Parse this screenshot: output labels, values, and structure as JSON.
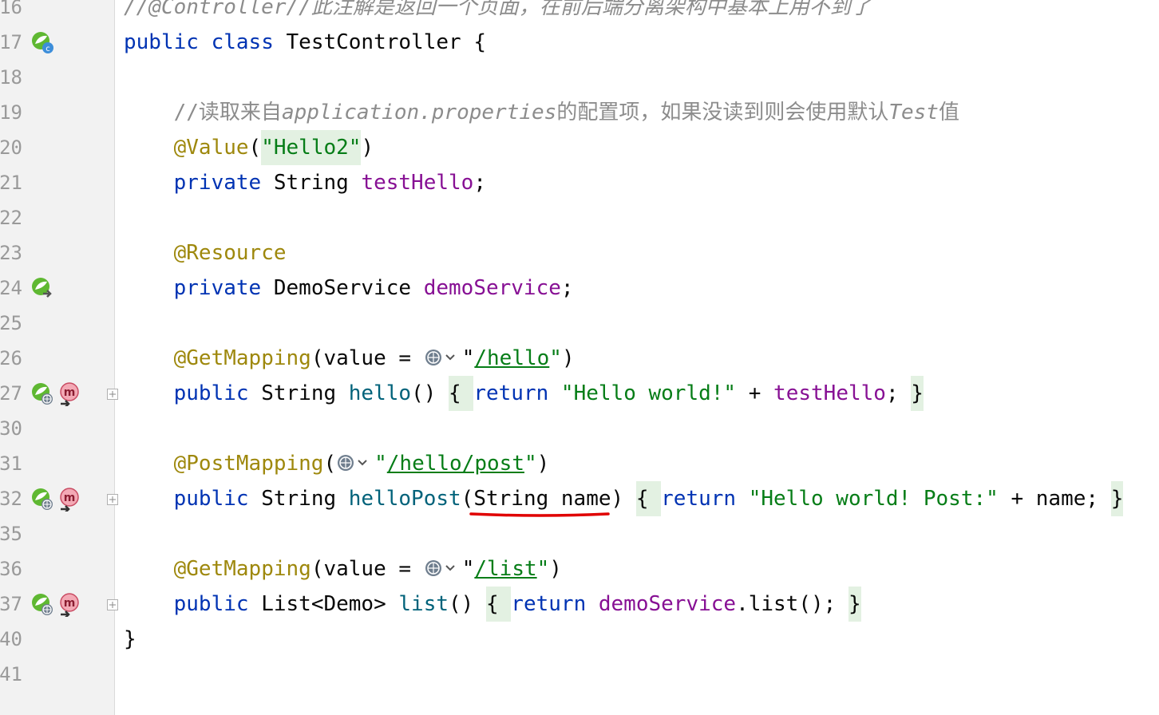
{
  "editor": {
    "lines": [
      {
        "num": "16",
        "parts": [
          {
            "t": "//@Controller//此注解是返回一个页面，在前后端分离架构中基本上用不到了",
            "c": "cmt ital"
          }
        ]
      },
      {
        "num": "17",
        "gutter": [
          "spring-bean-icon"
        ],
        "parts": [
          {
            "t": "public",
            "c": "kw"
          },
          {
            "t": " "
          },
          {
            "t": "class",
            "c": "kw"
          },
          {
            "t": " TestController {"
          }
        ]
      },
      {
        "num": "18",
        "parts": []
      },
      {
        "num": "19",
        "parts": [
          {
            "t": "    "
          },
          {
            "t": "//读取来自",
            "c": "cmt"
          },
          {
            "t": "application.properties",
            "c": "cmt ital"
          },
          {
            "t": "的配置项，如果没读到则会使用默认",
            "c": "cmt"
          },
          {
            "t": "Test",
            "c": "cmt ital"
          },
          {
            "t": "值",
            "c": "cmt"
          }
        ]
      },
      {
        "num": "20",
        "parts": [
          {
            "t": "    "
          },
          {
            "t": "@Value",
            "c": "ann"
          },
          {
            "t": "("
          },
          {
            "t": "\"Hello2\"",
            "c": "str hl"
          },
          {
            "t": ")"
          }
        ]
      },
      {
        "num": "21",
        "parts": [
          {
            "t": "    "
          },
          {
            "t": "private",
            "c": "kw"
          },
          {
            "t": " String "
          },
          {
            "t": "testHello",
            "c": "fld"
          },
          {
            "t": ";"
          }
        ]
      },
      {
        "num": "22",
        "parts": []
      },
      {
        "num": "23",
        "parts": [
          {
            "t": "    "
          },
          {
            "t": "@Resource",
            "c": "ann"
          }
        ]
      },
      {
        "num": "24",
        "gutter": [
          "autowired-icon"
        ],
        "parts": [
          {
            "t": "    "
          },
          {
            "t": "private",
            "c": "kw"
          },
          {
            "t": " DemoService "
          },
          {
            "t": "demoService",
            "c": "fld"
          },
          {
            "t": ";"
          }
        ]
      },
      {
        "num": "25",
        "parts": []
      },
      {
        "num": "26",
        "parts": [
          {
            "t": "    "
          },
          {
            "t": "@GetMapping",
            "c": "ann"
          },
          {
            "t": "(value = "
          },
          {
            "inlay": "globe-icon"
          },
          {
            "t": "\""
          },
          {
            "t": "/hello",
            "c": "url"
          },
          {
            "t": "\"",
            "c": "str"
          },
          {
            "t": ")"
          }
        ]
      },
      {
        "num": "27",
        "gutter": [
          "request-mapping-icon",
          "method-icon"
        ],
        "fold": true,
        "parts": [
          {
            "t": "    "
          },
          {
            "t": "public",
            "c": "kw"
          },
          {
            "t": " String "
          },
          {
            "t": "hello",
            "c": "mth"
          },
          {
            "t": "() "
          },
          {
            "t": "{ ",
            "c": "hl"
          },
          {
            "t": "return",
            "c": "kw"
          },
          {
            "t": " "
          },
          {
            "t": "\"Hello world!\"",
            "c": "str"
          },
          {
            "t": " + "
          },
          {
            "t": "testHello",
            "c": "fld"
          },
          {
            "t": "; "
          },
          {
            "t": "}",
            "c": "hl"
          }
        ]
      },
      {
        "num": "30",
        "parts": []
      },
      {
        "num": "31",
        "parts": [
          {
            "t": "    "
          },
          {
            "t": "@PostMapping",
            "c": "ann"
          },
          {
            "t": "("
          },
          {
            "inlay": "globe-icon"
          },
          {
            "t": "\"",
            "c": "str"
          },
          {
            "t": "/hello/post",
            "c": "url"
          },
          {
            "t": "\"",
            "c": "str"
          },
          {
            "t": ")"
          }
        ]
      },
      {
        "num": "32",
        "gutter": [
          "request-mapping-icon",
          "method-icon"
        ],
        "fold": true,
        "parts": [
          {
            "t": "    "
          },
          {
            "t": "public",
            "c": "kw"
          },
          {
            "t": " String "
          },
          {
            "t": "helloPost",
            "c": "mth"
          },
          {
            "t": "(String name) "
          },
          {
            "t": "{ ",
            "c": "hl"
          },
          {
            "t": "return",
            "c": "kw"
          },
          {
            "t": " "
          },
          {
            "t": "\"Hello world! Post:\"",
            "c": "str"
          },
          {
            "t": " + name; "
          },
          {
            "t": "}",
            "c": "hl"
          }
        ]
      },
      {
        "num": "35",
        "parts": []
      },
      {
        "num": "36",
        "parts": [
          {
            "t": "    "
          },
          {
            "t": "@GetMapping",
            "c": "ann"
          },
          {
            "t": "(value = "
          },
          {
            "inlay": "globe-icon"
          },
          {
            "t": "\""
          },
          {
            "t": "/list",
            "c": "url"
          },
          {
            "t": "\"",
            "c": "str"
          },
          {
            "t": ")"
          }
        ]
      },
      {
        "num": "37",
        "gutter": [
          "request-mapping-icon",
          "method-icon"
        ],
        "fold": true,
        "parts": [
          {
            "t": "    "
          },
          {
            "t": "public",
            "c": "kw"
          },
          {
            "t": " List<Demo> "
          },
          {
            "t": "list",
            "c": "mth"
          },
          {
            "t": "() "
          },
          {
            "t": "{ ",
            "c": "hl"
          },
          {
            "t": "return",
            "c": "kw"
          },
          {
            "t": " "
          },
          {
            "t": "demoService",
            "c": "fld"
          },
          {
            "t": ".list(); "
          },
          {
            "t": "}",
            "c": "hl"
          }
        ]
      },
      {
        "num": "40",
        "parts": [
          {
            "t": "}"
          }
        ]
      },
      {
        "num": "41",
        "parts": []
      }
    ],
    "annotation_color": "#e00000"
  }
}
